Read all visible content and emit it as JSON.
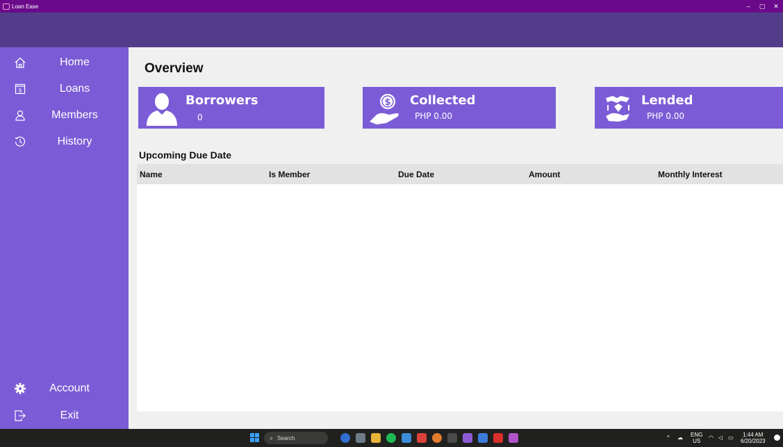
{
  "window": {
    "title": "Loan Ease",
    "controls": [
      "–",
      "▢",
      "✕"
    ]
  },
  "sidebar": {
    "items": [
      {
        "label": "Home",
        "icon": "home-icon"
      },
      {
        "label": "Loans",
        "icon": "loans-icon"
      },
      {
        "label": "Members",
        "icon": "members-icon"
      },
      {
        "label": "History",
        "icon": "history-icon"
      }
    ],
    "bottom": [
      {
        "label": "Account",
        "icon": "gear-icon"
      },
      {
        "label": "Exit",
        "icon": "exit-icon"
      }
    ]
  },
  "main": {
    "title": "Overview",
    "cards": [
      {
        "title": "Borrowers",
        "value": "0",
        "icon": "person-icon"
      },
      {
        "title": "Collected",
        "value": "PHP 0.00",
        "icon": "money-hand-icon"
      },
      {
        "title": "Lended",
        "value": "PHP 0.00",
        "icon": "lend-hands-icon"
      }
    ],
    "table": {
      "title": "Upcoming Due Date",
      "columns": [
        "Name",
        "Is Member",
        "Due Date",
        "Amount",
        "Monthly Interest"
      ],
      "rows": []
    }
  },
  "taskbar": {
    "search_placeholder": "Search",
    "lang": "ENG",
    "region": "US",
    "time": "1:44 AM",
    "date": "6/20/2023"
  },
  "colors": {
    "sidebar": "#7b5cd6",
    "header": "#533d8b",
    "titlebar": "#6a0a8a",
    "card": "#7b5cd6"
  }
}
